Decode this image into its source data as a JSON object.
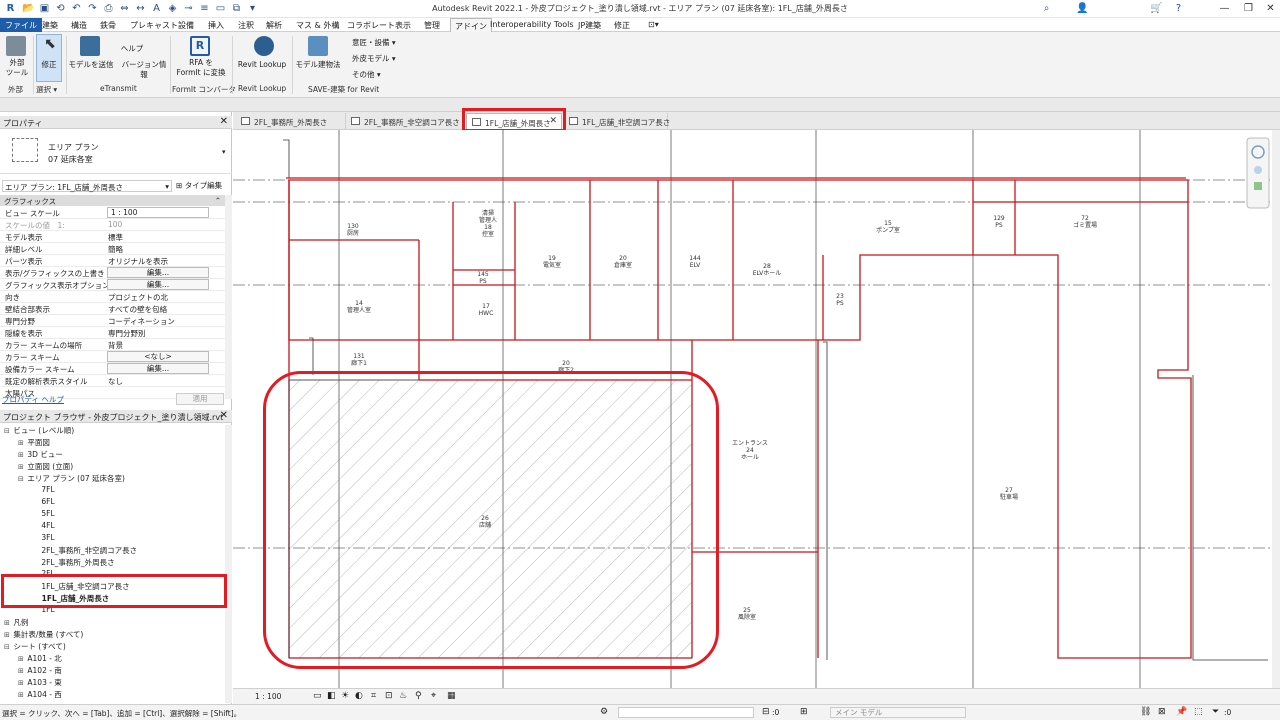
{
  "app": {
    "window_title": "Autodesk Revit 2022.1 - 外皮プロジェクト_塗り潰し領域.rvt - エリア プラン (07 延床各室): 1FL_店舗_外周長さ"
  },
  "menu": {
    "file": "ファイル",
    "tabs": [
      "建築",
      "構造",
      "鉄骨",
      "プレキャスト",
      "設備",
      "挿入",
      "注釈",
      "解析",
      "マス & 外構",
      "コラボレート",
      "表示",
      "管理",
      "アドイン",
      "Interoperability Tools",
      "JP建築",
      "修正"
    ]
  },
  "ribbon": {
    "external_tools": "外部\nツール",
    "modify": "修正",
    "send_model": "モデルを送信",
    "help": "ヘルプ",
    "version_info": "バージョン情報",
    "rfa_convert": "RFA を\nFormIt に変換",
    "revit_lookup": "Revit Lookup",
    "model_building": "モデル建物法",
    "design_settings": "意匠・設備",
    "envelope_model": "外皮モデル",
    "others": "その他",
    "groups": {
      "external": "外部",
      "select": "選択",
      "etransmit": "eTransmit",
      "formit": "FormIt コンバータ",
      "revit_lookup": "Revit Lookup",
      "save": "SAVE-建築 for Revit"
    }
  },
  "properties": {
    "header": "プロパティ",
    "type_line1": "エリア プラン",
    "type_line2": "07 延床各室",
    "instance_label": "エリア プラン: 1FL_店舗_外周長さ",
    "edit_type": "タイプ編集",
    "section": "グラフィックス",
    "rows": [
      {
        "k": "ビュー スケール",
        "v": "1 : 100"
      },
      {
        "k": "スケールの値　1:",
        "v": "100"
      },
      {
        "k": "モデル表示",
        "v": "標準"
      },
      {
        "k": "詳細レベル",
        "v": "簡略"
      },
      {
        "k": "パーツ表示",
        "v": "オリジナルを表示"
      },
      {
        "k": "表示/グラフィックスの上書き",
        "v": "編集..."
      },
      {
        "k": "グラフィックス表示オプション",
        "v": "編集..."
      },
      {
        "k": "向き",
        "v": "プロジェクトの北"
      },
      {
        "k": "壁結合部表示",
        "v": "すべての壁を包絡"
      },
      {
        "k": "専門分野",
        "v": "コーディネーション"
      },
      {
        "k": "隠線を表示",
        "v": "専門分野別"
      },
      {
        "k": "カラー スキームの場所",
        "v": "背景"
      },
      {
        "k": "カラー スキーム",
        "v": "<なし>"
      },
      {
        "k": "設備カラー スキーム",
        "v": "編集..."
      },
      {
        "k": "既定の解析表示スタイル",
        "v": "なし"
      },
      {
        "k": "太陽パス",
        "v": ""
      }
    ],
    "help_link": "プロパティ ヘルプ",
    "apply": "適用"
  },
  "browser": {
    "header": "プロジェクト ブラウザ - 外皮プロジェクト_塗り潰し領域.rvt",
    "items": [
      {
        "t": "ビュー (レベル順)",
        "lvl": 0,
        "tog": "⊟"
      },
      {
        "t": "平面図",
        "lvl": 1,
        "tog": "⊞"
      },
      {
        "t": "3D ビュー",
        "lvl": 1,
        "tog": "⊞"
      },
      {
        "t": "立面図 (立面)",
        "lvl": 1,
        "tog": "⊞"
      },
      {
        "t": "エリア プラン (07 延床各室)",
        "lvl": 1,
        "tog": "⊟"
      },
      {
        "t": "7FL",
        "lvl": 2,
        "tog": ""
      },
      {
        "t": "6FL",
        "lvl": 2,
        "tog": ""
      },
      {
        "t": "5FL",
        "lvl": 2,
        "tog": ""
      },
      {
        "t": "4FL",
        "lvl": 2,
        "tog": ""
      },
      {
        "t": "3FL",
        "lvl": 2,
        "tog": ""
      },
      {
        "t": "2FL_事務所_非空調コア長さ",
        "lvl": 2,
        "tog": ""
      },
      {
        "t": "2FL_事務所_外周長さ",
        "lvl": 2,
        "tog": ""
      },
      {
        "t": "2FL",
        "lvl": 2,
        "tog": ""
      },
      {
        "t": "1FL_店舗_非空調コア長さ",
        "lvl": 2,
        "tog": ""
      },
      {
        "t": "1FL_店舗_外周長さ",
        "lvl": 2,
        "tog": ""
      },
      {
        "t": "1FL",
        "lvl": 2,
        "tog": ""
      },
      {
        "t": "凡例",
        "lvl": 0,
        "tog": "⊞"
      },
      {
        "t": "集計表/数量 (すべて)",
        "lvl": 0,
        "tog": "⊞"
      },
      {
        "t": "シート (すべて)",
        "lvl": 0,
        "tog": "⊟"
      },
      {
        "t": "A101 - 北",
        "lvl": 1,
        "tog": "⊞"
      },
      {
        "t": "A102 - 南",
        "lvl": 1,
        "tog": "⊞"
      },
      {
        "t": "A103 - 東",
        "lvl": 1,
        "tog": "⊞"
      },
      {
        "t": "A104 - 西",
        "lvl": 1,
        "tog": "⊞"
      }
    ]
  },
  "tabs": [
    {
      "label": "2FL_事務所_外周長さ"
    },
    {
      "label": "2FL_事務所_非空調コア長さ"
    },
    {
      "label": "1FL_店舗_外周長さ"
    },
    {
      "label": "1FL_店舗_非空調コア長さ"
    }
  ],
  "rooms": [
    {
      "n": "130",
      "name": "厨房"
    },
    {
      "n": "清掃\n管理人\n18\n控室",
      "name": ""
    },
    {
      "n": "19",
      "name": "電気室"
    },
    {
      "n": "20",
      "name": "倉庫室"
    },
    {
      "n": "144",
      "name": "ELV"
    },
    {
      "n": "28",
      "name": "ELVホール"
    },
    {
      "n": "15",
      "name": "ポンプ室"
    },
    {
      "n": "129",
      "name": "PS"
    },
    {
      "n": "72",
      "name": "ゴミ置場"
    },
    {
      "n": "145",
      "name": "PS"
    },
    {
      "n": "17",
      "name": "HWC"
    },
    {
      "n": "14",
      "name": "管理人室"
    },
    {
      "n": "23",
      "name": "PS"
    },
    {
      "n": "131",
      "name": "廊下1"
    },
    {
      "n": "20",
      "name": "廊下2"
    },
    {
      "n": "26",
      "name": "店舗"
    },
    {
      "n": "エントランス\n24\nホール",
      "name": ""
    },
    {
      "n": "27",
      "name": "駐車場"
    },
    {
      "n": "25",
      "name": "風除室"
    }
  ],
  "viewbar": {
    "scale": "1 : 100"
  },
  "status": {
    "hint": "選択 = クリック、次へ = [Tab]、追加 = [Ctrl]、選択解除 = [Shift]。",
    "count": ":0",
    "model": "メイン モデル",
    "filter": ":0"
  }
}
